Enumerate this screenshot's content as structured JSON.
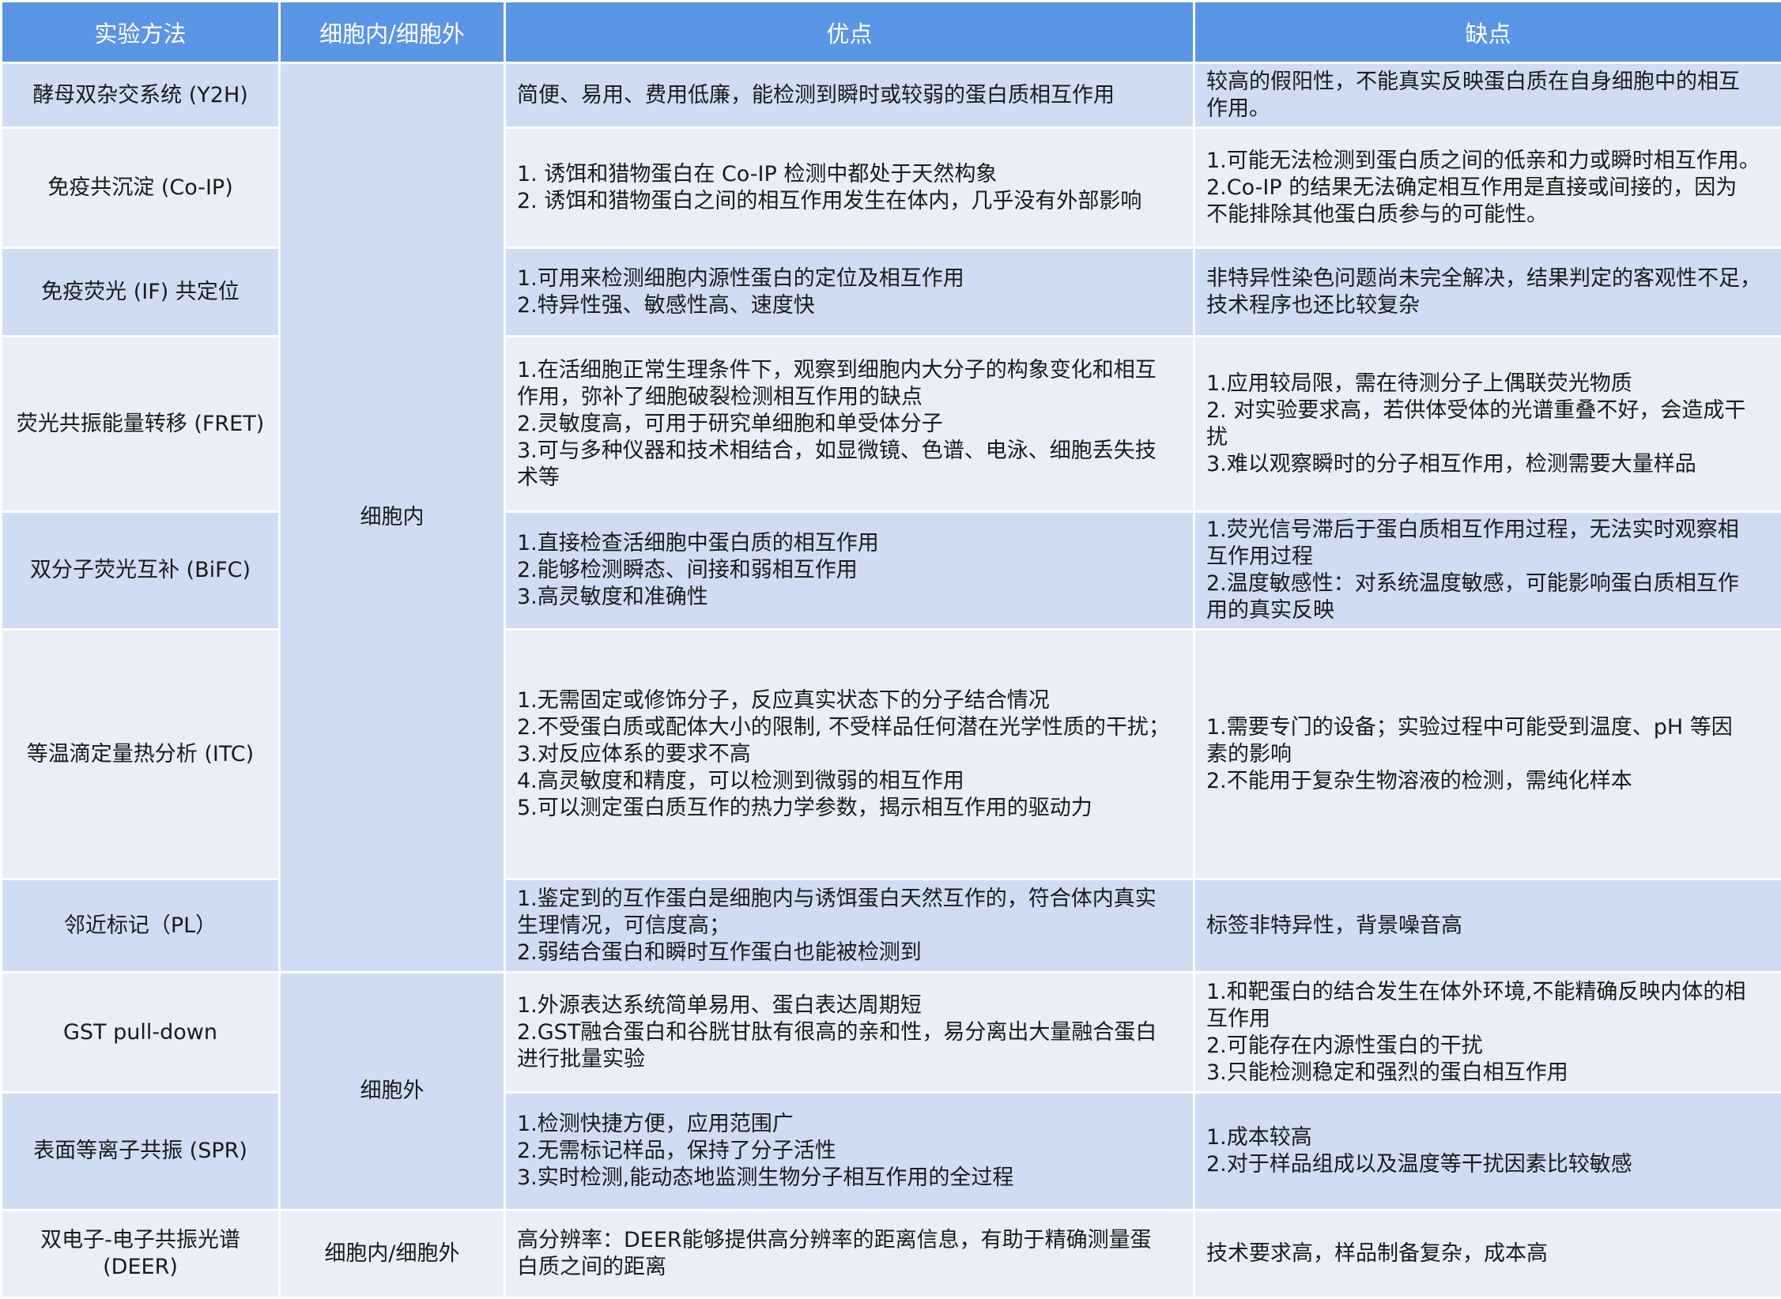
{
  "headers": [
    "实验方法",
    "细胞内/细胞外",
    "优点",
    "缺点"
  ],
  "rows": [
    {
      "method": "酵母双杂交系统 (Y2H)",
      "location": "细胞内",
      "pros": [
        "简便、易用、费用低廉，能检测到瞬时或较弱的蛋白质相互作用"
      ],
      "cons": [
        "较高的假阳性，不能真实反映蛋白质在自身细胞中的相互",
        "作用。"
      ]
    },
    {
      "method": "免疫共沉淀 (Co-IP)",
      "pros": [
        "1. 诱饵和猎物蛋白在 Co-IP 检测中都处于天然构象",
        "2. 诱饵和猎物蛋白之间的相互作用发生在体内，几乎没有外部影响"
      ],
      "cons": [
        "1.可能无法检测到蛋白质之间的低亲和力或瞬时相互作用。",
        "2.Co-IP 的结果无法确定相互作用是直接或间接的，因为",
        "不能排除其他蛋白质参与的可能性。"
      ]
    },
    {
      "method": "免疫荧光 (IF) 共定位",
      "pros": [
        "1.可用来检测细胞内源性蛋白的定位及相互作用",
        "2.特异性强、敏感性高、速度快"
      ],
      "cons": [
        "非特异性染色问题尚未完全解决，结果判定的客观性不足，",
        "技术程序也还比较复杂"
      ]
    },
    {
      "method": "荧光共振能量转移 (FRET)",
      "pros": [
        "1.在活细胞正常生理条件下，观察到细胞内大分子的构象变化和相互",
        "作用，弥补了细胞破裂检测相互作用的缺点",
        "2.灵敏度高，可用于研究单细胞和单受体分子",
        "3.可与多种仪器和技术相结合，如显微镜、色谱、电泳、细胞丢失技",
        "术等"
      ],
      "cons": [
        "1.应用较局限，需在待测分子上偶联荧光物质",
        "2. 对实验要求高，若供体受体的光谱重叠不好，会造成干",
        "扰",
        "3.难以观察瞬时的分子相互作用，检测需要大量样品"
      ]
    },
    {
      "method": "双分子荧光互补 (BiFC)",
      "pros": [
        "1.直接检查活细胞中蛋白质的相互作用",
        "2.能够检测瞬态、间接和弱相互作用",
        "3.高灵敏度和准确性"
      ],
      "cons": [
        "1.荧光信号滞后于蛋白质相互作用过程，无法实时观察相",
        "互作用过程",
        "2.温度敏感性：对系统温度敏感，可能影响蛋白质相互作",
        "用的真实反映"
      ]
    },
    {
      "method": "等温滴定量热分析 (ITC)",
      "pros": [
        "1.无需固定或修饰分子，反应真实状态下的分子结合情况",
        "2.不受蛋白质或配体大小的限制, 不受样品任何潜在光学性质的干扰；",
        "3.对反应体系的要求不高",
        "4.高灵敏度和精度，可以检测到微弱的相互作用",
        "5.可以测定蛋白质互作的热力学参数，揭示相互作用的驱动力"
      ],
      "cons": [
        "1.需要专门的设备；实验过程中可能受到温度、pH 等因",
        "素的影响",
        "2.不能用于复杂生物溶液的检测，需纯化样本"
      ]
    },
    {
      "method": "邻近标记（PL）",
      "pros": [
        "1.鉴定到的互作蛋白是细胞内与诱饵蛋白天然互作的，符合体内真实",
        "生理情况，可信度高；",
        "2.弱结合蛋白和瞬时互作蛋白也能被检测到"
      ],
      "cons": [
        "标签非特异性，背景噪音高"
      ]
    },
    {
      "method": "GST pull-down",
      "location": "细胞外",
      "pros": [
        "1.外源表达系统简单易用、蛋白表达周期短",
        "2.GST融合蛋白和谷胱甘肽有很高的亲和性，易分离出大量融合蛋白",
        "进行批量实验"
      ],
      "cons": [
        "1.和靶蛋白的结合发生在体外环境,不能精确反映内体的相",
        "互作用",
        "2.可能存在内源性蛋白的干扰",
        "3.只能检测稳定和强烈的蛋白相互作用"
      ]
    },
    {
      "method": "表面等离子共振 (SPR)",
      "pros": [
        "1.检测快捷方便，应用范围广",
        "2.无需标记样品，保持了分子活性",
        "3.实时检测,能动态地监测生物分子相互作用的全过程"
      ],
      "cons": [
        "1.成本较高",
        "2.对于样品组成以及温度等干扰因素比较敏感"
      ]
    },
    {
      "method": "双电子-电子共振光谱 (DEER)",
      "method_lines": [
        "双电子-电子共振光谱",
        "(DEER)"
      ],
      "location": "细胞内/细胞外",
      "pros": [
        "高分辨率：DEER能够提供高分辨率的距离信息，有助于精确测量蛋",
        "白质之间的距离"
      ],
      "cons": [
        "技术要求高，样品制备复杂，成本高"
      ]
    }
  ]
}
